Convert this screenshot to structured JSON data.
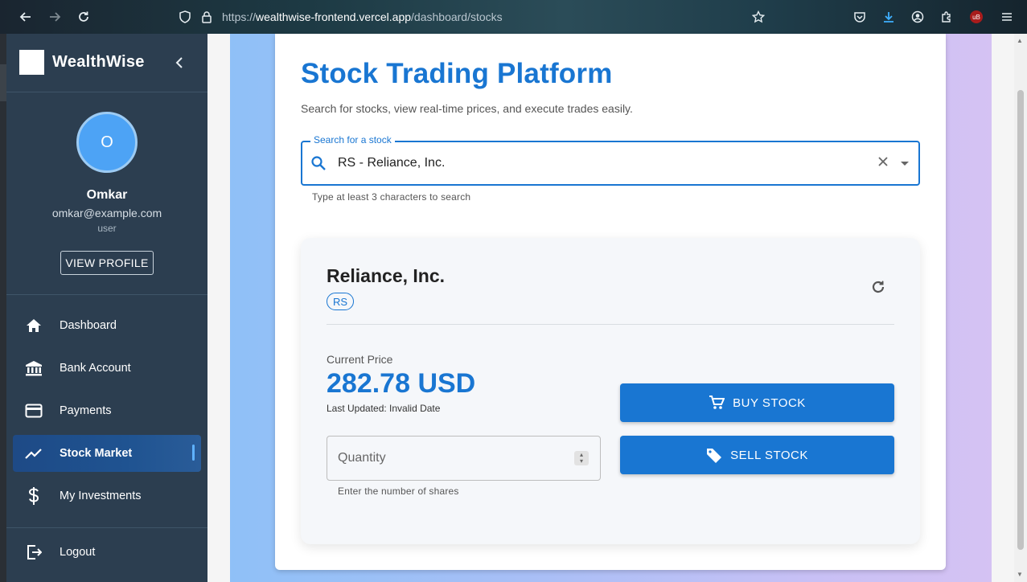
{
  "browser": {
    "url_prefix": "https://",
    "url_host": "wealthwise-frontend.vercel.app",
    "url_path": "/dashboard/stocks",
    "extension_badge": "uB"
  },
  "sidebar": {
    "brand": "WealthWise",
    "user": {
      "initial": "O",
      "name": "Omkar",
      "email": "omkar@example.com",
      "role": "user",
      "view_profile_label": "VIEW PROFILE"
    },
    "items": [
      {
        "label": "Dashboard",
        "icon": "home-icon"
      },
      {
        "label": "Bank Account",
        "icon": "bank-icon"
      },
      {
        "label": "Payments",
        "icon": "credit-card-icon"
      },
      {
        "label": "Stock Market",
        "icon": "trending-up-icon",
        "active": true
      },
      {
        "label": "My Investments",
        "icon": "dollar-icon"
      }
    ],
    "logout_label": "Logout"
  },
  "main": {
    "title": "Stock Trading Platform",
    "subtitle": "Search for stocks, view real-time prices, and execute trades easily.",
    "search": {
      "label": "Search for a stock",
      "value": "RS - Reliance, Inc.",
      "helper": "Type at least 3 characters to search"
    },
    "stock": {
      "name": "Reliance, Inc.",
      "symbol": "RS",
      "price_label": "Current Price",
      "price": "282.78 USD",
      "last_updated": "Last Updated: Invalid Date",
      "quantity_placeholder": "Quantity",
      "quantity_helper": "Enter the number of shares",
      "buy_label": "BUY STOCK",
      "sell_label": "SELL STOCK"
    }
  },
  "colors": {
    "primary": "#1976d2",
    "sidebar_bg": "#2c3e50",
    "active_item": "#1f5391",
    "avatar": "#4da3f5"
  }
}
